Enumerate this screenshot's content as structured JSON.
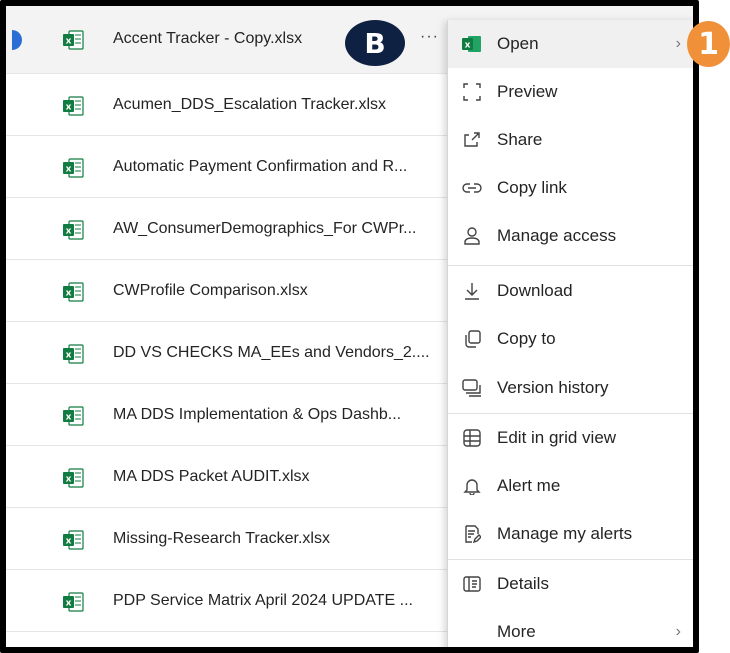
{
  "files": [
    {
      "name": "Accent Tracker - Copy.xlsx",
      "selected": true
    },
    {
      "name": "Acumen_DDS_Escalation Tracker.xlsx"
    },
    {
      "name": "Automatic Payment Confirmation and R..."
    },
    {
      "name": "AW_ConsumerDemographics_For CWPr..."
    },
    {
      "name": "CWProfile Comparison.xlsx"
    },
    {
      "name": "DD VS CHECKS MA_EEs and Vendors_2...."
    },
    {
      "name": "MA DDS Implementation & Ops Dashb..."
    },
    {
      "name": "MA DDS Packet AUDIT.xlsx"
    },
    {
      "name": "Missing-Research Tracker.xlsx"
    },
    {
      "name": "PDP Service Matrix April 2024 UPDATE ..."
    }
  ],
  "row_more_label": "···",
  "callouts": {
    "b": "B",
    "one": "1"
  },
  "menu": {
    "items": [
      {
        "label": "Open",
        "icon": "excel-icon",
        "submenu": true,
        "active": true
      },
      {
        "label": "Preview",
        "icon": "preview-icon"
      },
      {
        "label": "Share",
        "icon": "share-icon"
      },
      {
        "label": "Copy link",
        "icon": "link-icon"
      },
      {
        "label": "Manage access",
        "icon": "person-icon"
      },
      {
        "label": "Download",
        "icon": "download-icon"
      },
      {
        "label": "Copy to",
        "icon": "copy-icon"
      },
      {
        "label": "Version history",
        "icon": "version-history-icon"
      },
      {
        "label": "Edit in grid view",
        "icon": "grid-icon"
      },
      {
        "label": "Alert me",
        "icon": "bell-icon"
      },
      {
        "label": "Manage my alerts",
        "icon": "manage-alerts-icon"
      },
      {
        "label": "Details",
        "icon": "details-icon"
      },
      {
        "label": "More",
        "icon": "",
        "submenu": true
      }
    ],
    "chevron": "›"
  },
  "colors": {
    "excel_green": "#107c41",
    "badge_b": "#0f2143",
    "badge_1": "#f0913a",
    "selected_check": "#2b6fd6"
  }
}
